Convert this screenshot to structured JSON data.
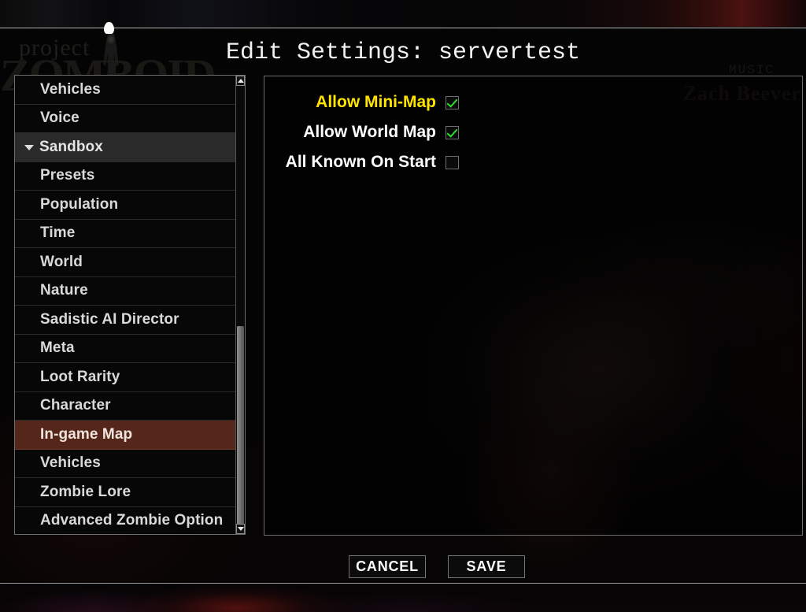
{
  "window": {
    "title": "Edit Settings: servertest"
  },
  "background": {
    "logo_line1": "project",
    "logo_line2": "ZOMBOID",
    "credit_label": "MUSIC",
    "credit_name": "Zach Beever"
  },
  "sidebar": {
    "items": [
      {
        "label": "Vehicles",
        "type": "item",
        "state": "normal"
      },
      {
        "label": "Voice",
        "type": "item",
        "state": "normal"
      },
      {
        "label": "Sandbox",
        "type": "group",
        "state": "expanded"
      },
      {
        "label": "Presets",
        "type": "item",
        "state": "normal"
      },
      {
        "label": "Population",
        "type": "item",
        "state": "normal"
      },
      {
        "label": "Time",
        "type": "item",
        "state": "normal"
      },
      {
        "label": "World",
        "type": "item",
        "state": "normal"
      },
      {
        "label": "Nature",
        "type": "item",
        "state": "normal"
      },
      {
        "label": "Sadistic AI Director",
        "type": "item",
        "state": "normal"
      },
      {
        "label": "Meta",
        "type": "item",
        "state": "normal"
      },
      {
        "label": "Loot Rarity",
        "type": "item",
        "state": "normal"
      },
      {
        "label": "Character",
        "type": "item",
        "state": "normal"
      },
      {
        "label": "In-game Map",
        "type": "item",
        "state": "selected"
      },
      {
        "label": "Vehicles",
        "type": "item",
        "state": "normal"
      },
      {
        "label": "Zombie Lore",
        "type": "item",
        "state": "normal"
      },
      {
        "label": "Advanced Zombie Option",
        "type": "item",
        "state": "normal"
      }
    ],
    "selected_label": "In-game Map",
    "selected_color": "#55271a",
    "group_color": "#2a2a2a"
  },
  "settings": {
    "rows": [
      {
        "label": "Allow Mini-Map",
        "checked": true,
        "highlighted": true
      },
      {
        "label": "Allow World Map",
        "checked": true,
        "highlighted": false
      },
      {
        "label": "All Known On Start",
        "checked": false,
        "highlighted": false
      }
    ],
    "highlight_color": "#ffe400",
    "check_color": "#2fe02f"
  },
  "footer": {
    "cancel_label": "CANCEL",
    "save_label": "SAVE"
  }
}
